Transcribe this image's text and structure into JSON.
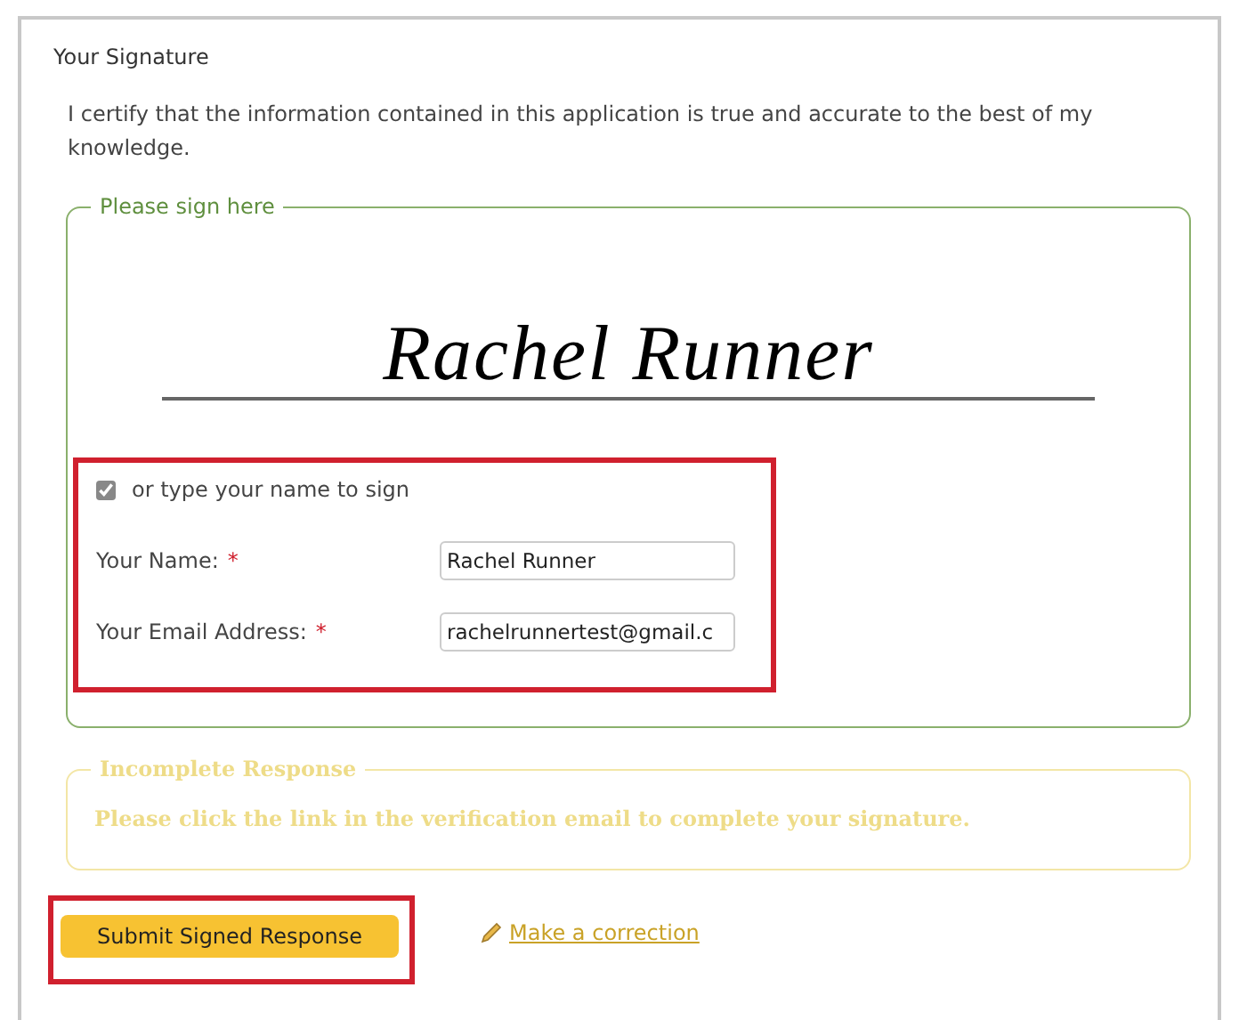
{
  "title": "Your Signature",
  "statement": "I certify that the information contained in this application is true and accurate to the best of my knowledge.",
  "sign_box": {
    "legend": "Please sign here",
    "signature": "Rachel Runner",
    "type_to_sign": {
      "label": "or type your name to sign",
      "checked": true
    },
    "fields": [
      {
        "label": "Your Name:",
        "required": true,
        "value": "Rachel Runner"
      },
      {
        "label": "Your Email Address:",
        "required": true,
        "value": "rachelrunnertest@gmail.c"
      }
    ],
    "required_mark": "*"
  },
  "status_box": {
    "legend": "Incomplete Response",
    "message": "Please click the link in the verification email to complete your signature."
  },
  "submit_button": "Submit Signed Response",
  "correction_link": "Make a correction"
}
